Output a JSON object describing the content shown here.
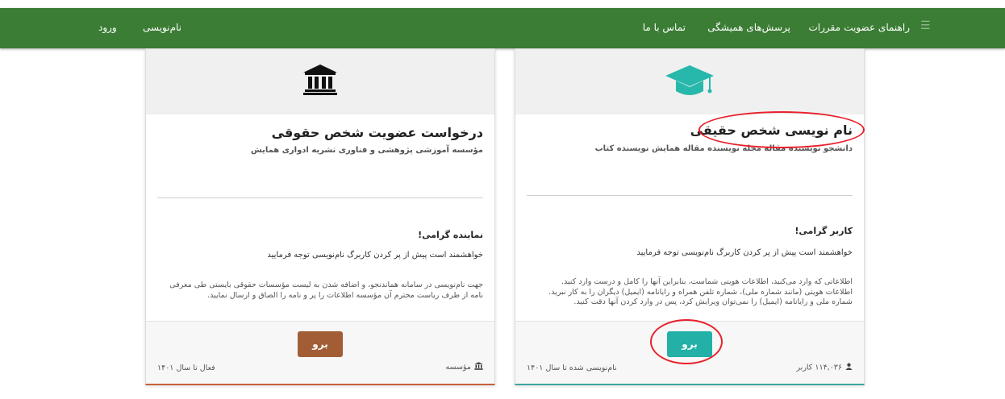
{
  "nav": {
    "guide": "راهنمای عضویت",
    "rules": "مقررات",
    "faq": "پرسش‌های همیشگی",
    "contact": "تماس با ما",
    "register": "نام‌نویسی",
    "login": "ورود"
  },
  "cards": {
    "natural": {
      "icon": "graduation-cap-icon",
      "title": "نام نویسی شخص حقیقی",
      "subtitle": "دانشجو   نویسنده مقاله مجله   نویسنده مقاله همایش   نویسنده کتاب",
      "greeting": "کاربر گرامی!",
      "note": "خواهشمند است پیش از پر کردن کاربرگ نام‌نویسی توجه فرمایید",
      "info": [
        "اطلاعاتی که وارد می‌کنید، اطلاعات هویتی شماست، بنابراین آنها را کامل و درست وارد کنید.",
        "اطلاعات هویتی (مانند شماره ملی)، شماره تلفن همراه و رایانامه (ایمیل) دیگران را به کار نبرید.",
        "شماره ملی و رایانامه (ایمیل) را نمی‌توان ویرایش کرد، پس در وارد کردن آنها دقت کنید."
      ],
      "button": "برو",
      "count_label": "۱۱۴,۰۳۶ کاربر",
      "status": "نام‌نویسی شده تا سال ۱۴۰۱",
      "accent": "#22b0a7"
    },
    "legal": {
      "icon": "institution-icon",
      "title": "درخواست عضویت شخص حقوقی",
      "subtitle": "مؤسسه آموزشی پژوهشی و فناوری   نشریه ادواری   همایش",
      "greeting": "نماینده گرامی!",
      "note": "خواهشمند است پیش از پر کردن کاربرگ نام‌نویسی توجه فرمایید",
      "info": [
        "جهت نام‌نویسی در سامانه هماندنجو، و اضافه شدن به لیست مؤسسات حقوقی بایستی طی معرفی",
        "نامه از طرف ریاست محترم آن مؤسسه اطلاعات را پر و نامه را الصاق و ارسال نمایید."
      ],
      "button": "برو",
      "count_label": "مؤسسه",
      "status": "فعال تا سال ۱۴۰۱",
      "accent": "#a25d35"
    }
  },
  "colors": {
    "navbar": "#3b7d35",
    "annotation": "#e8202a"
  }
}
